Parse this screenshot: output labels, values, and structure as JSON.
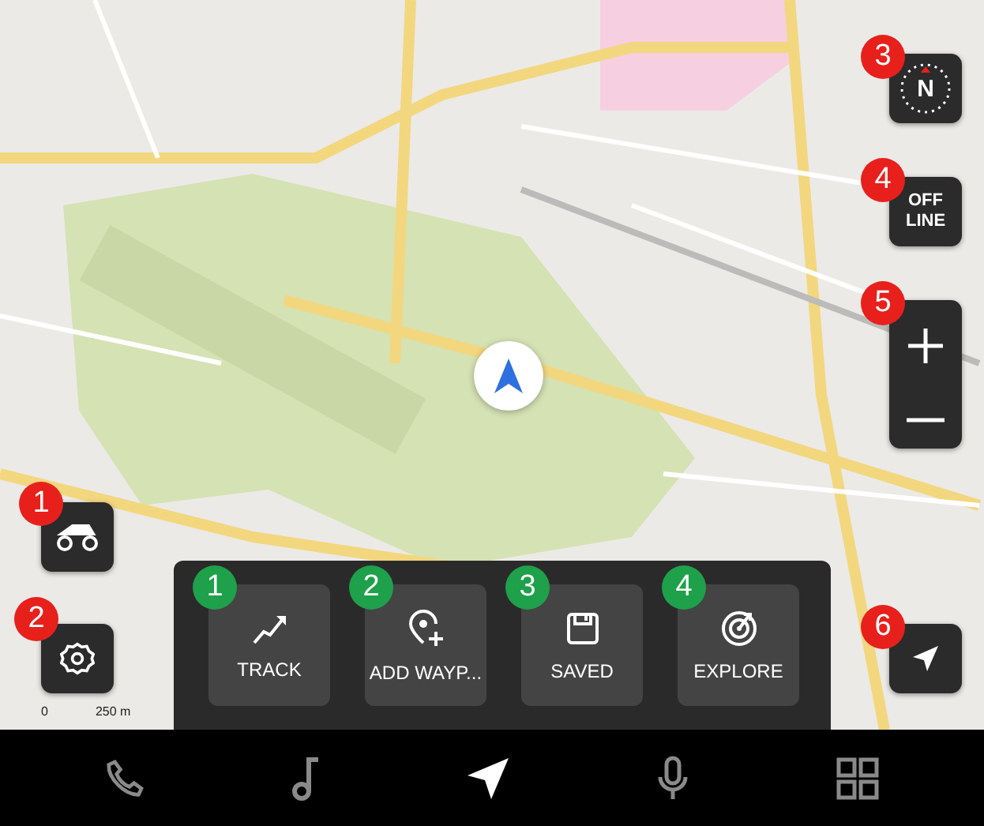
{
  "map_controls": [
    {
      "kind": "vehicle",
      "badge": "1"
    },
    {
      "kind": "settings",
      "badge": "2"
    },
    {
      "kind": "compass",
      "badge": "3",
      "label": "N"
    },
    {
      "kind": "offline",
      "badge": "4",
      "label": "OFF LINE"
    },
    {
      "kind": "zoom",
      "badge": "5"
    },
    {
      "kind": "recenter",
      "badge": "6"
    }
  ],
  "scale": {
    "start": "0",
    "distance": "250 m"
  },
  "action_panel": [
    {
      "kind": "track",
      "badge": "1",
      "label": "TRACK"
    },
    {
      "kind": "waypoint",
      "badge": "2",
      "label": "ADD WAYP..."
    },
    {
      "kind": "saved",
      "badge": "3",
      "label": "SAVED"
    },
    {
      "kind": "explore",
      "badge": "4",
      "label": "EXPLORE"
    }
  ],
  "nav_bar": [
    {
      "kind": "phone",
      "selected": false
    },
    {
      "kind": "music",
      "selected": false
    },
    {
      "kind": "navigation",
      "selected": true
    },
    {
      "kind": "microphone",
      "selected": false
    },
    {
      "kind": "apps",
      "selected": false
    }
  ]
}
